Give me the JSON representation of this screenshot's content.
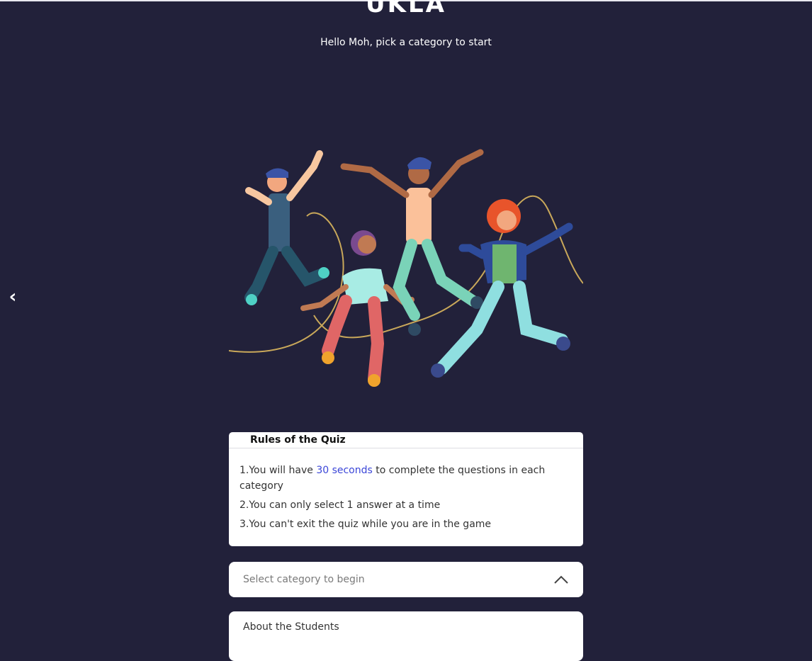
{
  "app": {
    "brand": "UKLA",
    "greeting": "Hello Moh, pick a category to start"
  },
  "nav": {
    "back_icon": "chevron-left-icon"
  },
  "rules": {
    "title": "Rules of the Quiz",
    "items": [
      {
        "prefix": "1.You will have ",
        "highlight": "30 seconds",
        "suffix": " to complete the questions in each category"
      },
      {
        "text": "2.You can only select 1 answer at a time"
      },
      {
        "text": "3.You can't exit the quiz while you are in the game"
      }
    ],
    "highlight_color": "#3b46d8"
  },
  "category_select": {
    "placeholder": "Select category to begin",
    "icon": "chevron-up-icon"
  },
  "about": {
    "title": "About the Students"
  },
  "colors": {
    "background": "#22213a",
    "card": "#ffffff"
  }
}
